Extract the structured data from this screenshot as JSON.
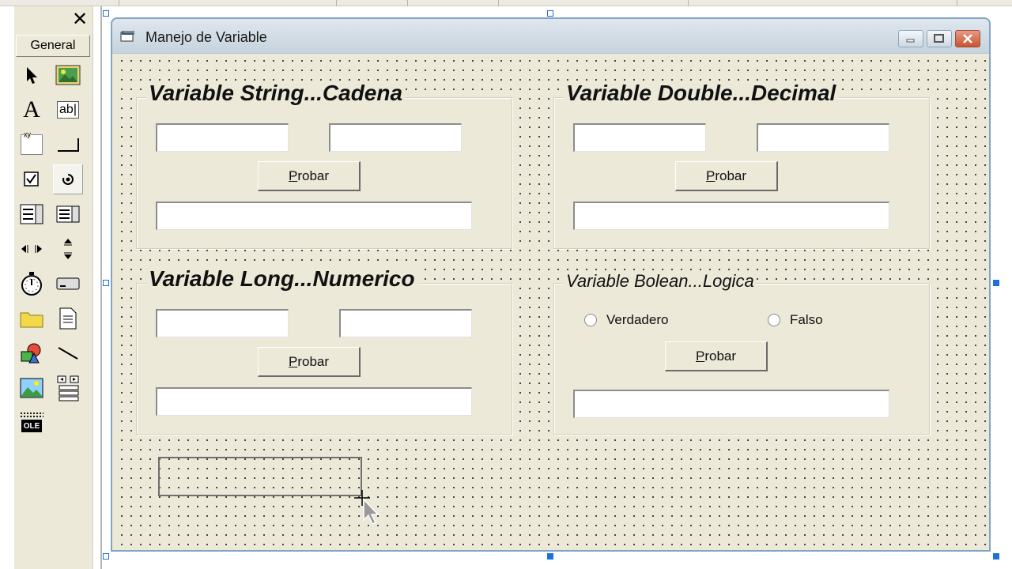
{
  "toolbox": {
    "close_label": "✕",
    "tab_label": "General",
    "tools": [
      {
        "name": "pointer-tool-icon"
      },
      {
        "name": "picturebox-tool-icon"
      },
      {
        "name": "label-tool-icon",
        "glyph": "A"
      },
      {
        "name": "textbox-tool-icon",
        "glyph": "ab|"
      },
      {
        "name": "frame-tool-icon",
        "glyph": "xy"
      },
      {
        "name": "commandbutton-tool-icon"
      },
      {
        "name": "checkbox-tool-icon"
      },
      {
        "name": "optionbutton-tool-icon"
      },
      {
        "name": "combobox-tool-icon"
      },
      {
        "name": "listbox-tool-icon"
      },
      {
        "name": "hscrollbar-tool-icon"
      },
      {
        "name": "vscrollbar-tool-icon"
      },
      {
        "name": "timer-tool-icon"
      },
      {
        "name": "drivelistbox-tool-icon"
      },
      {
        "name": "dirlistbox-tool-icon"
      },
      {
        "name": "filelistbox-tool-icon"
      },
      {
        "name": "shape-tool-icon"
      },
      {
        "name": "line-tool-icon"
      },
      {
        "name": "image-tool-icon"
      },
      {
        "name": "data-tool-icon"
      },
      {
        "name": "ole-tool-icon",
        "glyph": "OLE"
      }
    ]
  },
  "form": {
    "title": "Manejo de Variable",
    "frames": {
      "string": {
        "title": "Variable String...Cadena",
        "button": "Probar"
      },
      "double": {
        "title": "Variable Double...Decimal",
        "button": "Probar"
      },
      "long": {
        "title": "Variable Long...Numerico",
        "button": "Probar"
      },
      "bolean": {
        "title": "Variable Bolean...Logica",
        "button": "Probar",
        "radio_true": "Verdadero",
        "radio_false": "Falso"
      }
    }
  },
  "colors": {
    "form_background": "#ece9d8",
    "title_bar": "#c6d3dd",
    "selection_handle": "#1e6fe0",
    "close_button": "#c9532f"
  }
}
